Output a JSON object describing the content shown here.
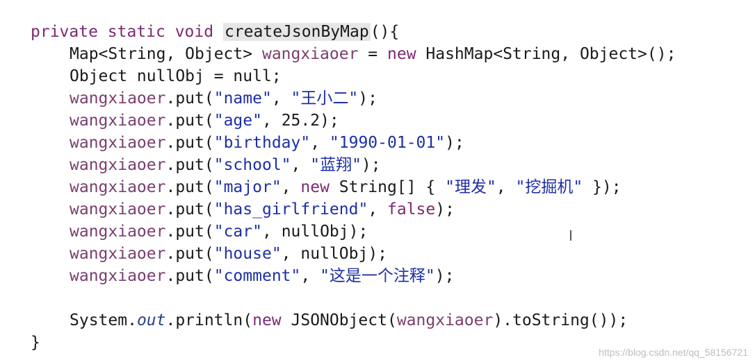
{
  "code": {
    "l1": {
      "kw1": "private static void",
      "method": "createJsonByMap",
      "rest": "(){"
    },
    "l2": {
      "type": "Map<String, Object>",
      "var": "wangxiaoer",
      "eq": " = ",
      "kw": "new",
      "ctor": " HashMap<String, Object>();"
    },
    "l3": {
      "text": "Object nullObj = null;"
    },
    "l4": {
      "var": "wangxiaoer",
      "call": ".put(",
      "key": "\"name\"",
      "sep": ", ",
      "val": "\"王小二\"",
      "end": ");"
    },
    "l5": {
      "var": "wangxiaoer",
      "call": ".put(",
      "key": "\"age\"",
      "sep": ", ",
      "val": "25.2",
      "end": ");"
    },
    "l6": {
      "var": "wangxiaoer",
      "call": ".put(",
      "key": "\"birthday\"",
      "sep": ", ",
      "val": "\"1990-01-01\"",
      "end": ");"
    },
    "l7": {
      "var": "wangxiaoer",
      "call": ".put(",
      "key": "\"school\"",
      "sep": ", ",
      "val": "\"蓝翔\"",
      "end": ");"
    },
    "l8": {
      "var": "wangxiaoer",
      "call": ".put(",
      "key": "\"major\"",
      "sep": ", ",
      "kw": "new",
      "type": " String[] { ",
      "v1": "\"理发\"",
      "comma": ", ",
      "v2": "\"挖掘机\"",
      "end": " });"
    },
    "l9": {
      "var": "wangxiaoer",
      "call": ".put(",
      "key": "\"has_girlfriend\"",
      "sep": ", ",
      "val": "false",
      "end": ");"
    },
    "l10": {
      "var": "wangxiaoer",
      "call": ".put(",
      "key": "\"car\"",
      "sep": ", ",
      "val": "nullObj",
      "end": ");"
    },
    "l11": {
      "var": "wangxiaoer",
      "call": ".put(",
      "key": "\"house\"",
      "sep": ", ",
      "val": "nullObj",
      "end": ");"
    },
    "l12": {
      "var": "wangxiaoer",
      "call": ".put(",
      "key": "\"comment\"",
      "sep": ", ",
      "val": "\"这是一个注释\"",
      "end": ");"
    },
    "l13": {
      "sys": "System.",
      "out": "out",
      "print": ".println(",
      "kw": "new",
      "json": " JSONObject(",
      "var": "wangxiaoer",
      "end": ").toString());"
    },
    "l14": {
      "text": "}"
    }
  },
  "cursor_glyph": "I",
  "watermark": "https://blog.csdn.net/qq_58156721"
}
